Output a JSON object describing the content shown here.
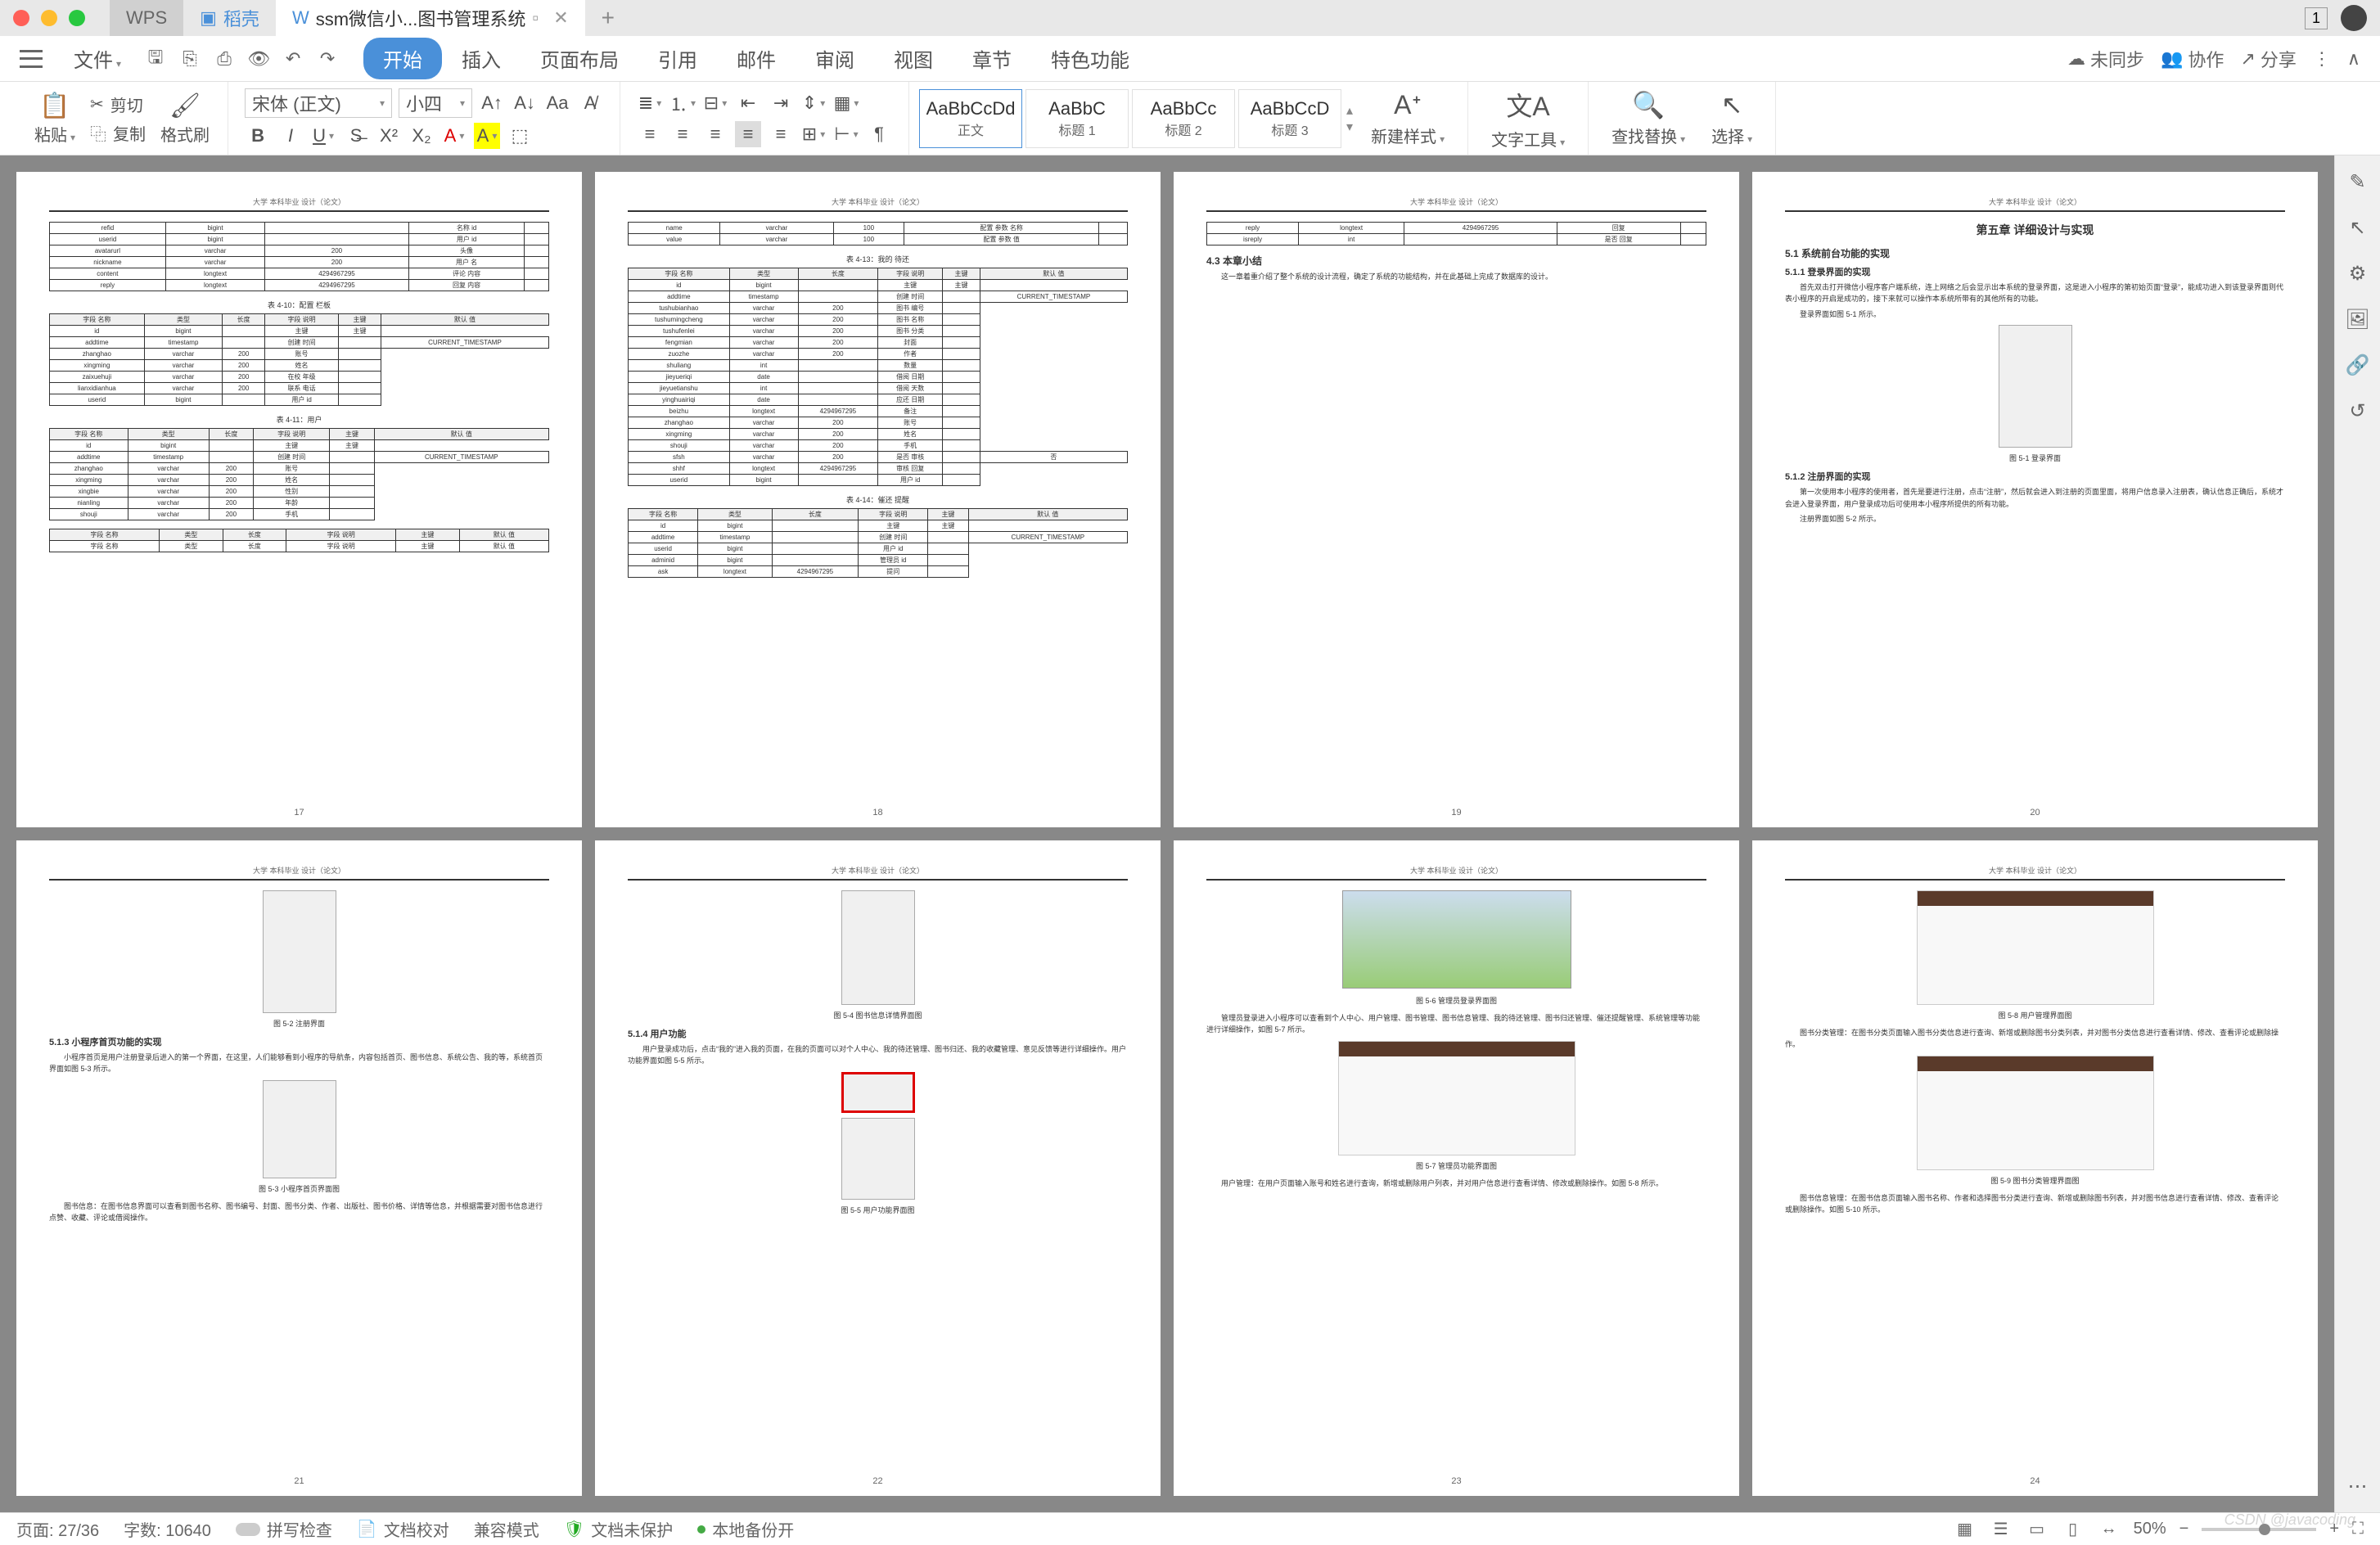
{
  "titlebar": {
    "tabs": {
      "wps": "WPS",
      "daoke": "稻壳",
      "active": "ssm微信小...图书管理系统"
    },
    "badge": "1"
  },
  "menubar": {
    "file": "文件",
    "tabs": [
      "开始",
      "插入",
      "页面布局",
      "引用",
      "邮件",
      "审阅",
      "视图",
      "章节",
      "特色功能"
    ],
    "right": {
      "sync": "未同步",
      "collab": "协作",
      "share": "分享"
    }
  },
  "ribbon": {
    "paste": "粘贴",
    "cut": "剪切",
    "copy": "复制",
    "fmtpaint": "格式刷",
    "font_name": "宋体 (正文)",
    "font_size": "小四",
    "styles": [
      {
        "preview": "AaBbCcDd",
        "name": "正文"
      },
      {
        "preview": "AaBbC",
        "name": "标题 1"
      },
      {
        "preview": "AaBbCc",
        "name": "标题 2"
      },
      {
        "preview": "AaBbCcD",
        "name": "标题 3"
      }
    ],
    "newstyle": "新建样式",
    "texttool": "文字工具",
    "findrep": "查找替换",
    "select": "选择"
  },
  "doc": {
    "header": "大学 本科毕业 设计（论文）",
    "pages": {
      "p17": {
        "num": "17",
        "cap1": "表 4-10：配置 栏板",
        "cap2": "表 4-11：用户",
        "hdr": [
          "字段 名称",
          "类型",
          "长度",
          "字段 说明",
          "主键",
          "默认 值"
        ],
        "rows1": [
          [
            "refid",
            "bigint",
            "",
            "名称 id",
            ""
          ],
          [
            "userid",
            "bigint",
            "",
            "用户 id",
            ""
          ],
          [
            "avatarurl",
            "varchar",
            "200",
            "头像",
            ""
          ],
          [
            "nickname",
            "varchar",
            "200",
            "用户 名",
            ""
          ],
          [
            "content",
            "longtext",
            "4294967295",
            "评论 内容",
            ""
          ],
          [
            "reply",
            "longtext",
            "4294967295",
            "回复 内容",
            ""
          ]
        ],
        "rows2": [
          [
            "id",
            "bigint",
            "",
            "主键",
            "主键"
          ],
          [
            "addtime",
            "timestamp",
            "",
            "创建 时间",
            "",
            "CURRENT_TIMESTAMP"
          ],
          [
            "zhanghao",
            "varchar",
            "200",
            "账号",
            ""
          ],
          [
            "xingming",
            "varchar",
            "200",
            "姓名",
            ""
          ],
          [
            "zaixuehuji",
            "varchar",
            "200",
            "在校 年级",
            ""
          ],
          [
            "lianxidianhua",
            "varchar",
            "200",
            "联系 电话",
            ""
          ],
          [
            "userid",
            "bigint",
            "",
            "用户 id",
            ""
          ]
        ],
        "rows3": [
          [
            "id",
            "bigint",
            "",
            "主键",
            "主键"
          ],
          [
            "addtime",
            "timestamp",
            "",
            "创建 时间",
            "",
            "CURRENT_TIMESTAMP"
          ],
          [
            "zhanghao",
            "varchar",
            "200",
            "账号",
            ""
          ],
          [
            "xingming",
            "varchar",
            "200",
            "姓名",
            ""
          ],
          [
            "xingbie",
            "varchar",
            "200",
            "性别",
            ""
          ],
          [
            "nianling",
            "varchar",
            "200",
            "年龄",
            ""
          ],
          [
            "shouji",
            "varchar",
            "200",
            "手机",
            ""
          ]
        ]
      },
      "p18": {
        "num": "18",
        "cap1": "表 4-13：我的 待还",
        "cap2": "表 4-14：催还 提醒",
        "rows0": [
          [
            "name",
            "varchar",
            "100",
            "配置 参数 名称",
            ""
          ],
          [
            "value",
            "varchar",
            "100",
            "配置 参数 值",
            ""
          ]
        ],
        "rows1": [
          [
            "id",
            "bigint",
            "",
            "主键",
            "主键"
          ],
          [
            "addtime",
            "timestamp",
            "",
            "创建 时间",
            "",
            "CURRENT_TIMESTAMP"
          ],
          [
            "tushubianhao",
            "varchar",
            "200",
            "图书 编号",
            ""
          ],
          [
            "tushumingcheng",
            "varchar",
            "200",
            "图书 名称",
            ""
          ],
          [
            "tushufenlei",
            "varchar",
            "200",
            "图书 分类",
            ""
          ],
          [
            "fengmian",
            "varchar",
            "200",
            "封面",
            ""
          ],
          [
            "zuozhe",
            "varchar",
            "200",
            "作者",
            ""
          ],
          [
            "shuliang",
            "int",
            "",
            "数量",
            ""
          ],
          [
            "jieyueriqi",
            "date",
            "",
            "借阅 日期",
            ""
          ],
          [
            "jieyuetianshu",
            "int",
            "",
            "借阅 天数",
            ""
          ],
          [
            "yinghuairiqi",
            "date",
            "",
            "应还 日期",
            ""
          ],
          [
            "beizhu",
            "longtext",
            "4294967295",
            "备注",
            ""
          ],
          [
            "zhanghao",
            "varchar",
            "200",
            "账号",
            ""
          ],
          [
            "xingming",
            "varchar",
            "200",
            "姓名",
            ""
          ],
          [
            "shouji",
            "varchar",
            "200",
            "手机",
            ""
          ],
          [
            "sfsh",
            "varchar",
            "200",
            "是否 审核",
            "",
            "否"
          ],
          [
            "shhf",
            "longtext",
            "4294967295",
            "审核 回复",
            ""
          ],
          [
            "userid",
            "bigint",
            "",
            "用户 id",
            ""
          ]
        ],
        "rows2": [
          [
            "id",
            "bigint",
            "",
            "主键",
            "主键"
          ],
          [
            "addtime",
            "timestamp",
            "",
            "创建 时间",
            "",
            "CURRENT_TIMESTAMP"
          ],
          [
            "userid",
            "bigint",
            "",
            "用户 id",
            ""
          ],
          [
            "adminid",
            "bigint",
            "",
            "管理员 id",
            ""
          ],
          [
            "ask",
            "longtext",
            "4294967295",
            "提问",
            ""
          ]
        ]
      },
      "p19": {
        "num": "19",
        "h": "4.3 本章小结",
        "rows": [
          [
            "reply",
            "longtext",
            "4294967295",
            "回复",
            ""
          ],
          [
            "isreply",
            "int",
            "",
            "是否 回复",
            ""
          ]
        ],
        "p": "这一章着重介绍了整个系统的设计流程，确定了系统的功能结构，并在此基础上完成了数据库的设计。"
      },
      "p20": {
        "num": "20",
        "h1": "第五章 详细设计与实现",
        "h2": "5.1 系统前台功能的实现",
        "h3a": "5.1.1 登录界面的实现",
        "pa": "首先双击打开微信小程序客户端系统，连上网络之后会显示出本系统的登录界面，这是进入小程序的第初始页面“登录”，能成功进入到该登录界面则代表小程序的开启是成功的，接下来就可以操作本系统所带有的其他所有的功能。",
        "capA": "登录界面如图 5-1 所示。",
        "figA": "图 5-1 登录界面",
        "h3b": "5.1.2 注册界面的实现",
        "pb": "第一次使用本小程序的使用者，首先是要进行注册，点击“注册”，然后就会进入到注册的页面里面，将用户信息录入注册表，确认信息正确后，系统才会进入登录界面，用户登录成功后可使用本小程序所提供的所有功能。",
        "capB": "注册界面如图 5-2 所示。"
      },
      "p21": {
        "num": "21",
        "fig1": "图 5-2 注册界面",
        "h": "5.1.3 小程序首页功能的实现",
        "p": "小程序首页是用户注册登录后进入的第一个界面，在这里，人们能够看到小程序的导航条，内容包括首页、图书信息、系统公告、我的等，系统首页界面如图 5-3 所示。",
        "fig2": "图 5-3 小程序首页界面图",
        "p2": "图书信息：在图书信息界面可以查看到图书名称、图书编号、封面、图书分类、作者、出版社、图书价格、详情等信息，并根据需要对图书信息进行点赞、收藏、评论或借阅操作。"
      },
      "p22": {
        "num": "22",
        "fig1": "图 5-4 图书信息详情界面图",
        "h": "5.1.4 用户功能",
        "p": "用户登录成功后，点击“我的”进入我的页面，在我的页面可以对个人中心、我的待还管理、图书归还、我的收藏管理、意见反馈等进行详细操作。用户功能界面如图 5-5 所示。",
        "fig2": "图 5-5 用户功能界面图"
      },
      "p23": {
        "num": "23",
        "fig1": "图 5-6 管理员登录界面图",
        "p1": "管理员登录进入小程序可以查看到个人中心、用户管理、图书管理、图书信息管理、我的待还管理、图书归还管理、催还提醒管理、系统管理等功能进行详细操作，如图 5-7 所示。",
        "fig2": "图 5-7 管理员功能界面图",
        "p2": "用户管理：在用户页面输入账号和姓名进行查询，新增或删除用户列表，并对用户信息进行查看详情、修改或删除操作。如图 5-8 所示。"
      },
      "p24": {
        "num": "24",
        "fig1": "图 5-8 用户管理界面图",
        "p1": "图书分类管理：在图书分类页面输入图书分类信息进行查询、新增或删除图书分类列表，并对图书分类信息进行查看详情、修改、查看评论或删除操作。",
        "fig2": "图 5-9 图书分类管理界面图",
        "p2": "图书信息管理：在图书信息页面输入图书名称、作者和选择图书分类进行查询、新增或删除图书列表，并对图书信息进行查看详情、修改、查看评论或删除操作。如图 5-10 所示。"
      }
    }
  },
  "statusbar": {
    "page": "页面: 27/36",
    "words": "字数: 10640",
    "spell": "拼写检查",
    "proof": "文档校对",
    "compat": "兼容模式",
    "protect": "文档未保护",
    "backup": "本地备份开",
    "zoom": "50%"
  },
  "watermark": "CSDN @javacoding"
}
